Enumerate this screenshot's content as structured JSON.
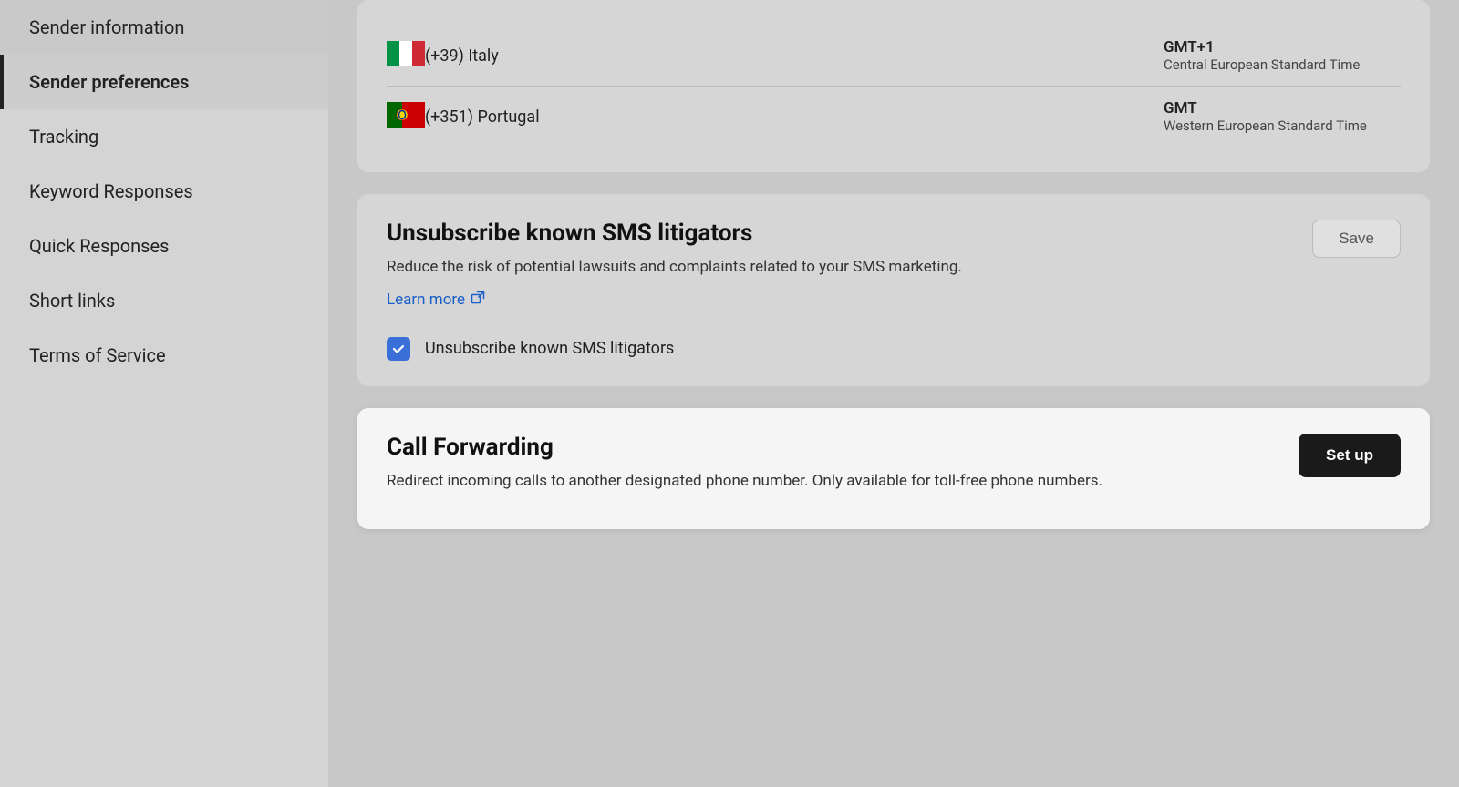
{
  "sidebar": {
    "items": [
      {
        "id": "sender-information",
        "label": "Sender information",
        "active": false
      },
      {
        "id": "sender-preferences",
        "label": "Sender preferences",
        "active": true
      },
      {
        "id": "tracking",
        "label": "Tracking",
        "active": false
      },
      {
        "id": "keyword-responses",
        "label": "Keyword Responses",
        "active": false
      },
      {
        "id": "quick-responses",
        "label": "Quick Responses",
        "active": false
      },
      {
        "id": "short-links",
        "label": "Short links",
        "active": false
      },
      {
        "id": "terms-of-service",
        "label": "Terms of Service",
        "active": false
      }
    ]
  },
  "phone_entries": [
    {
      "flag_type": "italy",
      "country": "(+39) Italy",
      "timezone_code": "GMT+1",
      "timezone_name": "Central European Standard Time"
    },
    {
      "flag_type": "portugal",
      "country": "(+351) Portugal",
      "timezone_code": "GMT",
      "timezone_name": "Western European Standard Time"
    }
  ],
  "unsubscribe_section": {
    "title": "Unsubscribe known SMS litigators",
    "description": "Reduce the risk of potential lawsuits and complaints related to your SMS marketing.",
    "learn_more_label": "Learn more",
    "checkbox_label": "Unsubscribe known SMS litigators",
    "checked": true,
    "save_label": "Save"
  },
  "call_forwarding": {
    "title": "Call Forwarding",
    "description": "Redirect incoming calls to another designated phone number. Only available for toll-free phone numbers.",
    "setup_label": "Set up"
  }
}
